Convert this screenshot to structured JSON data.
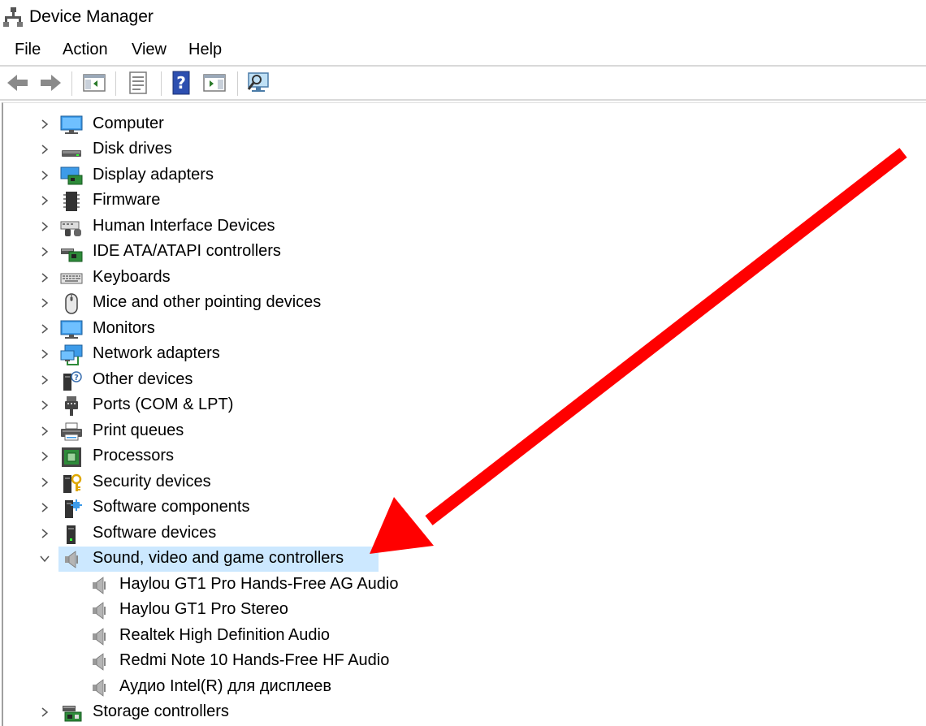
{
  "window": {
    "title": "Device Manager"
  },
  "menu": [
    "File",
    "Action",
    "View",
    "Help"
  ],
  "toolbar": {
    "buttons": [
      "back-icon",
      "forward-icon",
      "show-hide-console-tree-icon",
      "properties-icon",
      "help-icon",
      "action-pane-icon",
      "scan-hardware-icon"
    ]
  },
  "tree": {
    "categories": [
      {
        "label": "Computer",
        "icon": "computer-icon"
      },
      {
        "label": "Disk drives",
        "icon": "disk-drive-icon"
      },
      {
        "label": "Display adapters",
        "icon": "display-adapter-icon"
      },
      {
        "label": "Firmware",
        "icon": "firmware-icon"
      },
      {
        "label": "Human Interface Devices",
        "icon": "hid-icon"
      },
      {
        "label": "IDE ATA/ATAPI controllers",
        "icon": "ide-controller-icon"
      },
      {
        "label": "Keyboards",
        "icon": "keyboard-icon"
      },
      {
        "label": "Mice and other pointing devices",
        "icon": "mouse-icon"
      },
      {
        "label": "Monitors",
        "icon": "monitor-icon"
      },
      {
        "label": "Network adapters",
        "icon": "network-adapter-icon"
      },
      {
        "label": "Other devices",
        "icon": "other-devices-icon"
      },
      {
        "label": "Ports (COM & LPT)",
        "icon": "port-icon"
      },
      {
        "label": "Print queues",
        "icon": "printer-icon"
      },
      {
        "label": "Processors",
        "icon": "processor-icon"
      },
      {
        "label": "Security devices",
        "icon": "security-device-icon"
      },
      {
        "label": "Software components",
        "icon": "software-component-icon"
      },
      {
        "label": "Software devices",
        "icon": "software-device-icon"
      },
      {
        "label": "Sound, video and game controllers",
        "icon": "speaker-icon",
        "expanded": true,
        "selected": true,
        "children": [
          "Haylou GT1 Pro Hands-Free AG Audio",
          "Haylou GT1 Pro Stereo",
          "Realtek High Definition Audio",
          "Redmi Note 10 Hands-Free HF Audio",
          "Аудио Intel(R) для дисплеев"
        ]
      },
      {
        "label": "Storage controllers",
        "icon": "storage-controller-icon"
      }
    ]
  },
  "annotation": {
    "type": "arrow",
    "color": "#ff0000"
  }
}
